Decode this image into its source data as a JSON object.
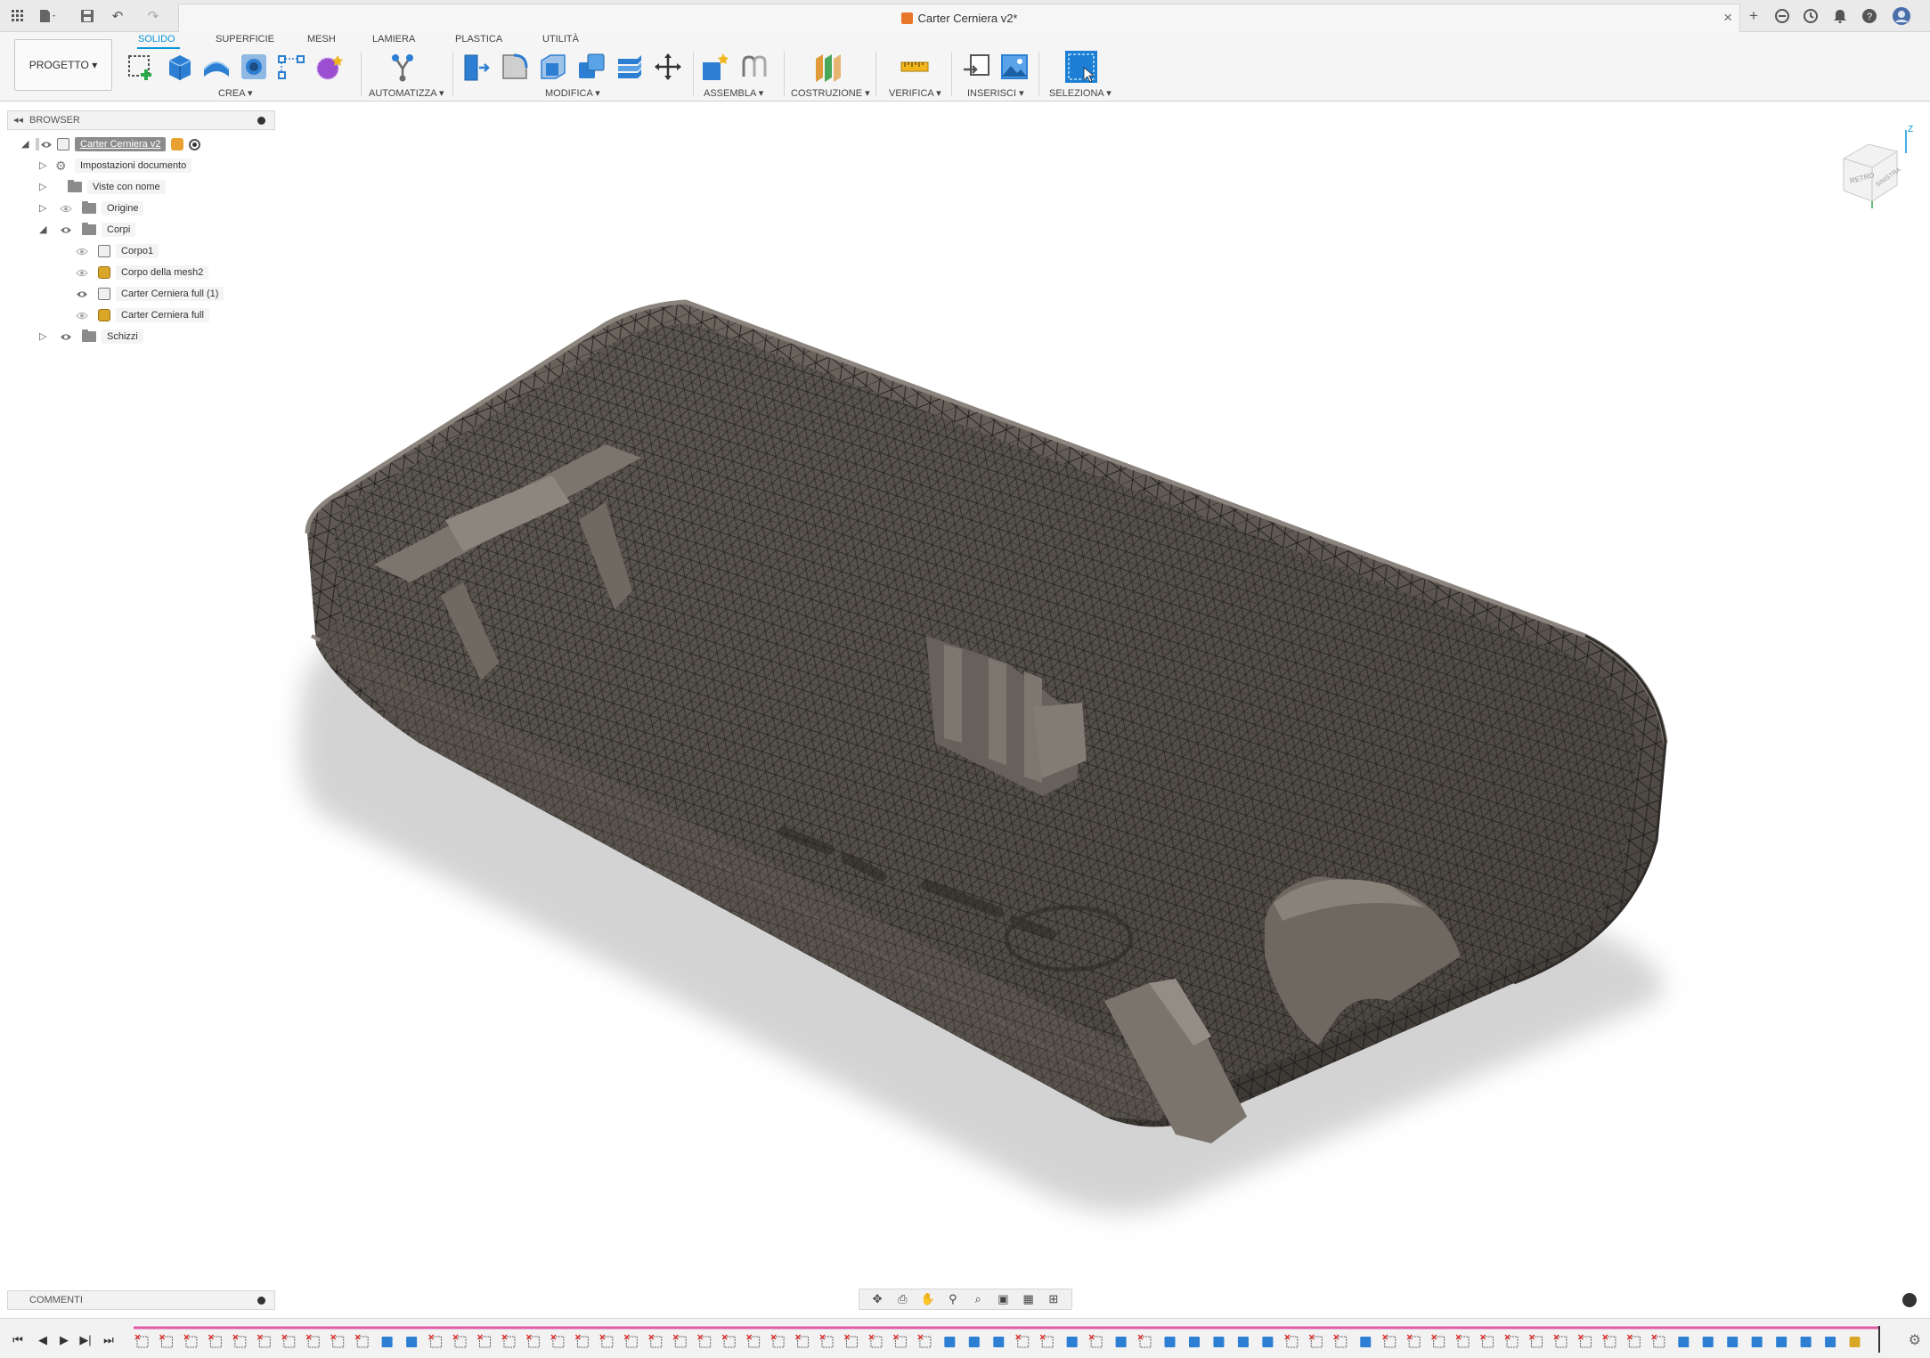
{
  "document": {
    "title": "Carter Cerniera v2*"
  },
  "ribbon": {
    "workspace_label": "PROGETTO ▾",
    "tabs": [
      {
        "label": "SOLIDO",
        "active": true
      },
      {
        "label": "SUPERFICIE",
        "active": false
      },
      {
        "label": "MESH",
        "active": false
      },
      {
        "label": "LAMIERA",
        "active": false
      },
      {
        "label": "PLASTICA",
        "active": false
      },
      {
        "label": "UTILITÀ",
        "active": false
      }
    ],
    "groups": {
      "crea": "CREA ▾",
      "automatizza": "AUTOMATIZZA ▾",
      "modifica": "MODIFICA ▾",
      "assembla": "ASSEMBLA ▾",
      "costruzione": "COSTRUZIONE ▾",
      "verifica": "VERIFICA ▾",
      "inserisci": "INSERISCI ▾",
      "seleziona": "SELEZIONA ▾"
    }
  },
  "browser": {
    "header": "BROWSER",
    "root": "Carter Cerniera v2",
    "nodes": {
      "impostazioni": "Impostazioni documento",
      "viste": "Viste con nome",
      "origine": "Origine",
      "corpi": "Corpi",
      "schizzi": "Schizzi"
    },
    "bodies": [
      {
        "label": "Corpo1",
        "type": "solid",
        "visible": false
      },
      {
        "label": "Corpo della mesh2",
        "type": "mesh",
        "visible": false
      },
      {
        "label": "Carter Cerniera full (1)",
        "type": "solid",
        "visible": true
      },
      {
        "label": "Carter Cerniera full",
        "type": "mesh",
        "visible": false
      }
    ]
  },
  "viewcube": {
    "faces": [
      "RETRO",
      "SINISTRA"
    ],
    "axis": "Z"
  },
  "comments": {
    "label": "COMMENTI"
  },
  "colors": {
    "accent": "#0696d7",
    "model_fill": "#4a4540",
    "mesh_wire": "#1a1816",
    "timeline_marker": "#e05aa8",
    "mesh_icon": "#d9a728"
  }
}
